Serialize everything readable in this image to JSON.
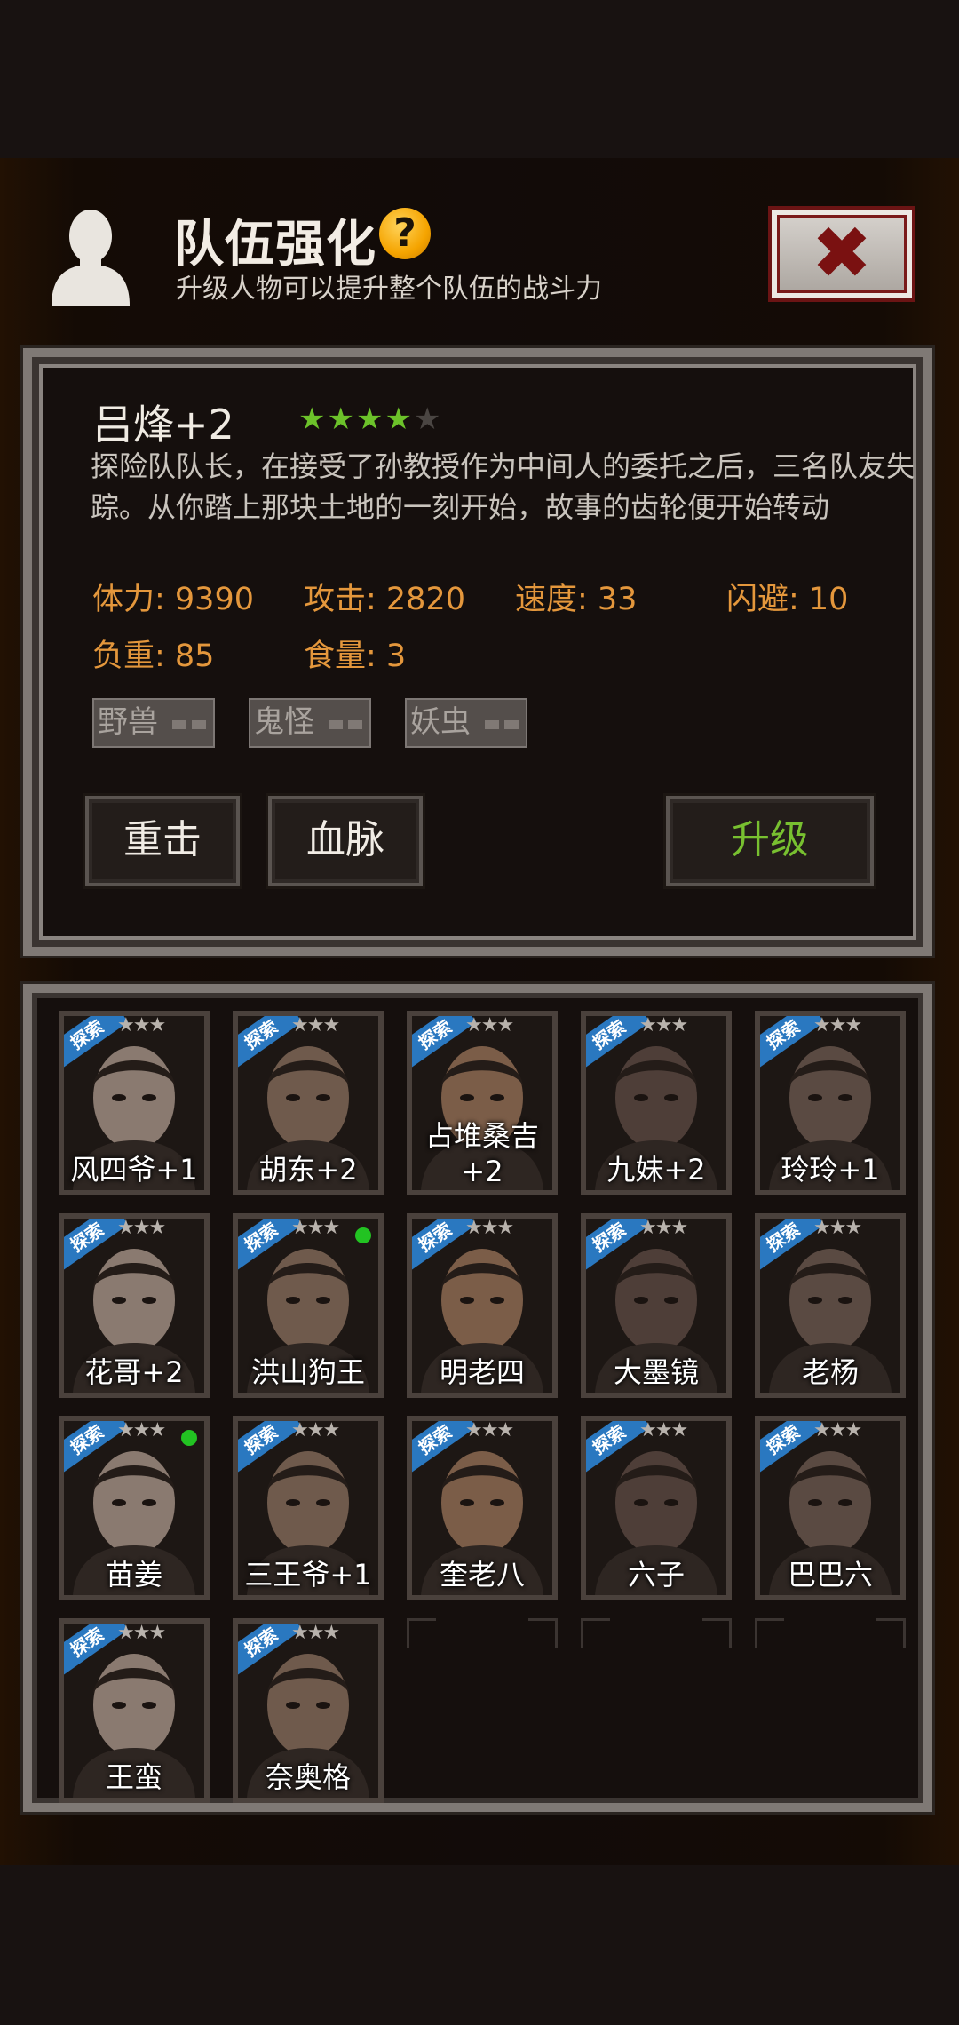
{
  "header": {
    "title": "队伍强化",
    "help_icon": "?",
    "subtitle": "升级人物可以提升整个队伍的战斗力",
    "close_icon": "✖"
  },
  "detail": {
    "name": "吕烽+2",
    "rating": {
      "filled": 4,
      "max": 5
    },
    "description": "探险队队长，在接受了孙教授作为中间人的委托之后，三名队友失踪。从你踏上那块土地的一刻开始，故事的齿轮便开始转动",
    "stats": {
      "stamina": "体力: 9390",
      "attack": "攻击: 2820",
      "speed": "速度: 33",
      "dodge": "闪避: 10",
      "load": "负重: 85",
      "food": "食量: 3"
    },
    "tags": [
      "野兽",
      "鬼怪",
      "妖虫"
    ],
    "buttons": {
      "skill1": "重击",
      "skill2": "血脉",
      "upgrade": "升级"
    }
  },
  "roster": {
    "ribbon_label": "探索",
    "cards": [
      {
        "name": "风四爷+1",
        "stars": "★★★",
        "dot": false
      },
      {
        "name": "胡东+2",
        "stars": "★★★",
        "dot": false
      },
      {
        "name": "占堆桑吉+2",
        "stars": "★★★",
        "dot": false
      },
      {
        "name": "九妹+2",
        "stars": "★★★",
        "dot": false
      },
      {
        "name": "玲玲+1",
        "stars": "★★★",
        "dot": false
      },
      {
        "name": "花哥+2",
        "stars": "★★★",
        "dot": false
      },
      {
        "name": "洪山狗王",
        "stars": "★★★",
        "dot": true
      },
      {
        "name": "明老四",
        "stars": "★★★",
        "dot": false
      },
      {
        "name": "大墨镜",
        "stars": "★★★",
        "dot": false
      },
      {
        "name": "老杨",
        "stars": "★★★",
        "dot": false
      },
      {
        "name": "苗姜",
        "stars": "★★★",
        "dot": true
      },
      {
        "name": "三王爷+1",
        "stars": "★★★",
        "dot": false
      },
      {
        "name": "奎老八",
        "stars": "★★★",
        "dot": false
      },
      {
        "name": "六子",
        "stars": "★★★",
        "dot": false
      },
      {
        "name": "巴巴六",
        "stars": "★★★",
        "dot": false
      },
      {
        "name": "王蛮",
        "stars": "★★★",
        "dot": false
      },
      {
        "name": "奈奥格",
        "stars": "★★★",
        "dot": false
      }
    ]
  },
  "colors": {
    "stat": "#e4973c",
    "upgrade": "#78c030",
    "star_filled": "#6cc22a",
    "ribbon": "#2a78c0"
  }
}
